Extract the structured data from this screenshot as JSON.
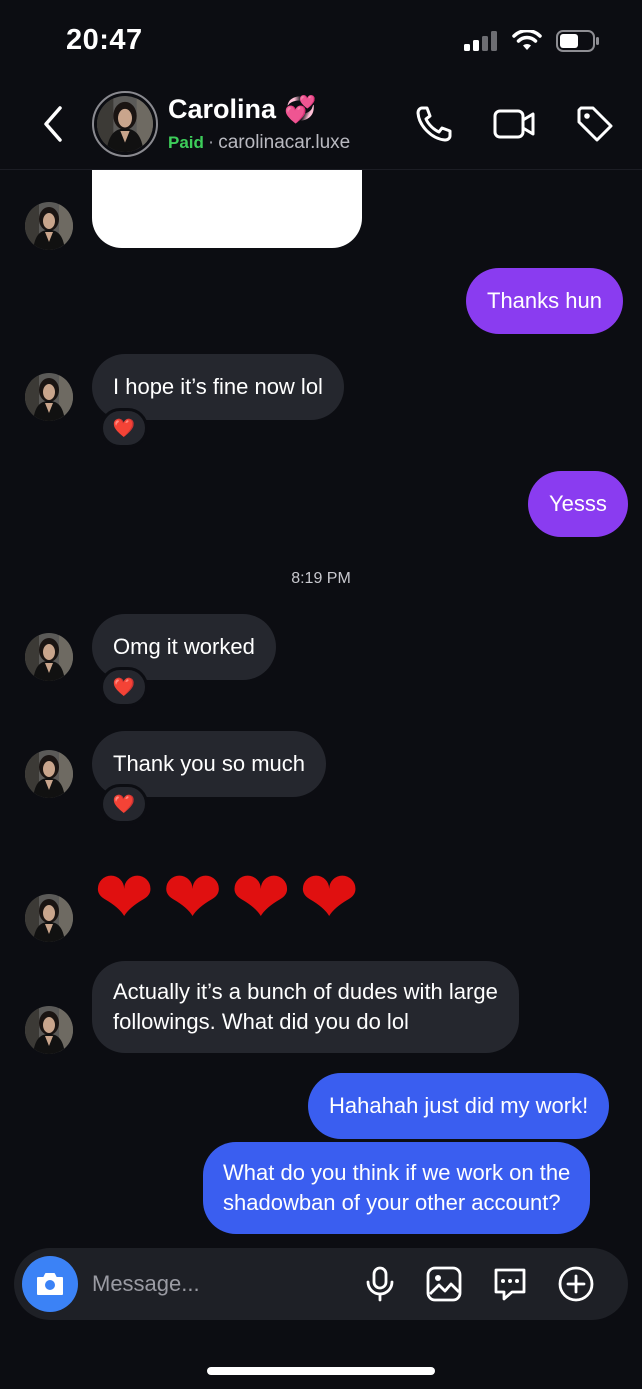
{
  "status_bar": {
    "time": "20:47"
  },
  "header": {
    "name": "Carolina",
    "name_emoji": "💞",
    "paid_label": "Paid",
    "separator": "·",
    "username": "carolinacar.luxe",
    "icons": [
      "phone-icon",
      "video-icon",
      "tag-icon"
    ]
  },
  "messages": [
    {
      "id": "m1",
      "side": "in",
      "kind": "image",
      "text": ""
    },
    {
      "id": "m2",
      "side": "out",
      "text": "Thanks hun",
      "color": "#8a3cf0"
    },
    {
      "id": "m3",
      "side": "in",
      "text": "I hope it’s fine now lol",
      "reaction": "❤️"
    },
    {
      "id": "m4",
      "side": "out",
      "text": "Yesss",
      "color": "#8a3cf0"
    },
    {
      "id": "m5",
      "side": "in",
      "text": "Omg it worked",
      "reaction": "❤️"
    },
    {
      "id": "m6",
      "side": "in",
      "text": "Thank you so much",
      "reaction": "❤️"
    },
    {
      "id": "m7",
      "side": "in",
      "kind": "emoji",
      "text": "❤️❤️❤️❤️"
    },
    {
      "id": "m8",
      "side": "in",
      "lines": [
        "Actually it’s a bunch of dudes with large",
        "followings. What did you do lol"
      ]
    },
    {
      "id": "m9",
      "side": "out",
      "text": "Hahahah just did my work!",
      "color": "#3a5ef0"
    },
    {
      "id": "m10",
      "side": "out",
      "lines": [
        "What do you think if we work on the",
        "shadowban of your other account?"
      ],
      "color": "#3a5ef0"
    }
  ],
  "timestamp": "8:19 PM",
  "composer": {
    "placeholder": "Message...",
    "icons": [
      "camera-icon",
      "microphone-icon",
      "gallery-icon",
      "sticker-icon",
      "plus-icon"
    ]
  },
  "colors": {
    "background": "#0c0d12",
    "incoming_bubble": "#25272e",
    "accent_purple": "#8a3cf0",
    "accent_blue": "#3a5ef0",
    "paid_green": "#3dcd5a"
  }
}
